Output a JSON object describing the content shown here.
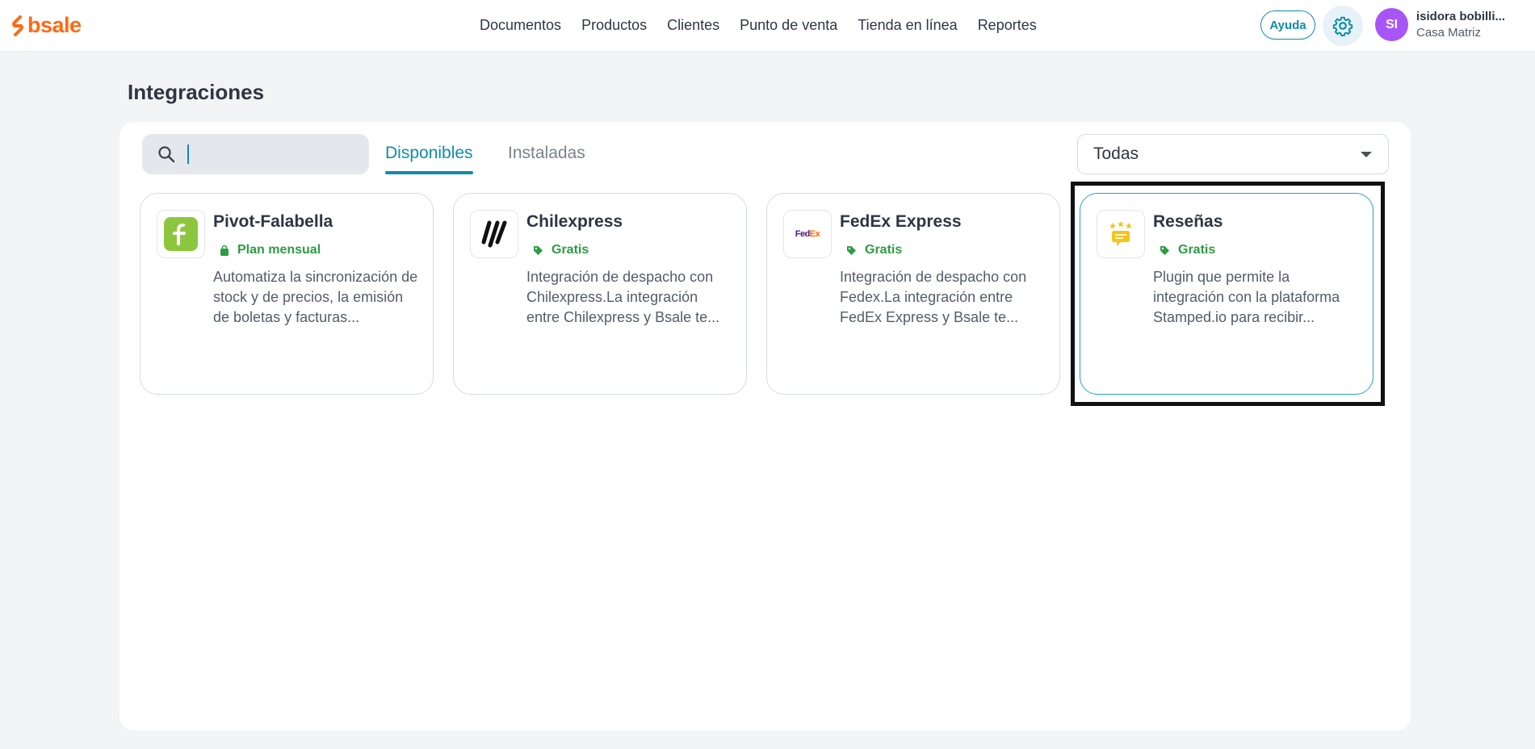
{
  "brand": {
    "name": "bsale",
    "color": "#ff6a13"
  },
  "nav": {
    "items": [
      {
        "label": "Documentos"
      },
      {
        "label": "Productos"
      },
      {
        "label": "Clientes"
      },
      {
        "label": "Punto de venta"
      },
      {
        "label": "Tienda en línea"
      },
      {
        "label": "Reportes"
      }
    ]
  },
  "header": {
    "help_label": "Ayuda",
    "settings_icon": "gear-icon",
    "user": {
      "initials": "SI",
      "name": "isidora bobilli...",
      "branch": "Casa Matriz",
      "avatar_color": "#a855f7"
    }
  },
  "page": {
    "title": "Integraciones"
  },
  "toolbar": {
    "search": {
      "value": "",
      "placeholder": ""
    },
    "tabs": [
      {
        "label": "Disponibles",
        "active": true
      },
      {
        "label": "Instaladas",
        "active": false
      }
    ],
    "filter": {
      "selected": "Todas"
    }
  },
  "cards": [
    {
      "title": "Pivot-Falabella",
      "tag_icon": "shopping-bag-icon",
      "tag": "Plan mensual",
      "description": "Automatiza la sincronización de stock y de precios, la emisión de boletas y facturas...",
      "logo": "falabella-logo"
    },
    {
      "title": "Chilexpress",
      "tag_icon": "price-tag-icon",
      "tag": "Gratis",
      "description": "Integración de despacho con Chilexpress.La integración entre Chilexpress y Bsale te...",
      "logo": "chilexpress-logo"
    },
    {
      "title": "FedEx Express",
      "tag_icon": "price-tag-icon",
      "tag": "Gratis",
      "description": "Integración de despacho con Fedex.La integración entre FedEx Express y Bsale te...",
      "logo": "fedex-logo",
      "logo_text": {
        "fed": "Fed",
        "ex": "Ex"
      }
    },
    {
      "title": "Reseñas",
      "tag_icon": "price-tag-icon",
      "tag": "Gratis",
      "description": "Plugin que permite la integración con la plataforma Stamped.io para recibir...",
      "logo": "reviews-logo",
      "selected": true
    }
  ],
  "colors": {
    "accent": "#0f8ba8",
    "tag_green": "#2e9b45",
    "falabella_green": "#8cc63f"
  }
}
